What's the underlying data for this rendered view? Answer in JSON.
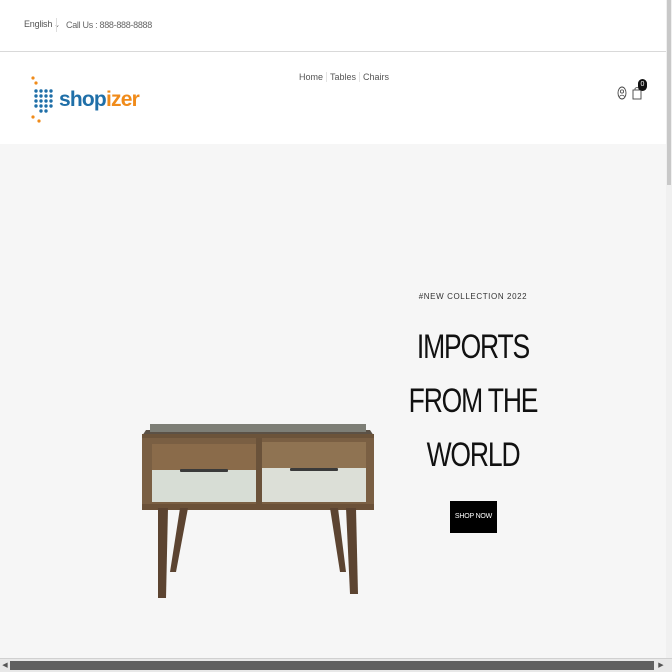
{
  "topbar": {
    "language": "English",
    "language_caret": "⌄",
    "phone": "Call Us : 888-888-8888"
  },
  "logo": {
    "shop": "shop",
    "izer": "izer"
  },
  "nav": {
    "items": [
      "Home",
      "Tables",
      "Chairs"
    ]
  },
  "cart": {
    "count": "0"
  },
  "hero": {
    "tag": "#NEW COLLECTION 2022",
    "title_lines": [
      "IMPORTS",
      "FROM THE",
      "WORLD"
    ],
    "button": "SHOP NOW"
  },
  "icons": {
    "user": "user-circle-icon",
    "cart": "shopping-bag-icon",
    "logo_mark": "dotted-logo-mark-icon"
  },
  "colors": {
    "brand_blue": "#1f6fa8",
    "brand_orange": "#f08b1a",
    "hero_bg": "#f6f6f6",
    "button_bg": "#000000"
  }
}
